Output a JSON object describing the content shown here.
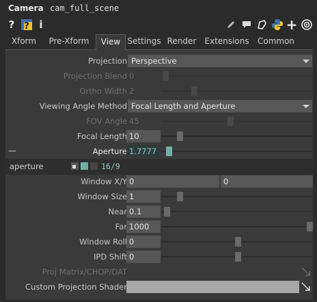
{
  "header": {
    "op_type": "Camera",
    "op_name": "cam_full_scene"
  },
  "toolbar": {
    "icons": [
      "help-icon",
      "python-help-icon",
      "info-icon",
      "edit-icon",
      "comment-icon",
      "clone-icon",
      "python-icon",
      "add-icon",
      "target-icon"
    ],
    "help_glyph": "?",
    "info_glyph": "i",
    "add_glyph": "+"
  },
  "tabs": [
    "Xform",
    "Pre-Xform",
    "View",
    "Settings",
    "Render",
    "Extensions",
    "Common"
  ],
  "active_tab": "View",
  "params": {
    "projection": {
      "label": "Projection",
      "value": "Perspective"
    },
    "projection_blend": {
      "label": "Projection Blend",
      "value": "0"
    },
    "ortho_width": {
      "label": "Ortho Width",
      "value": "2"
    },
    "viewing_angle_method": {
      "label": "Viewing Angle Method",
      "value": "Focal Length and Aperture"
    },
    "fov_angle": {
      "label": "FOV Angle",
      "value": "45"
    },
    "focal_length": {
      "label": "Focal Length",
      "value": "10"
    },
    "aperture": {
      "collapse_glyph": "—",
      "label": "Aperture",
      "value": "1.7777"
    },
    "aperture_expr": {
      "label": "aperture",
      "value": "16/9"
    },
    "window_xy": {
      "label": "Window X/Y",
      "x": "0",
      "y": "0"
    },
    "window_size": {
      "label": "Window Size",
      "value": "1"
    },
    "near": {
      "label": "Near",
      "value": "0.1"
    },
    "far": {
      "label": "Far",
      "value": "1000"
    },
    "window_roll": {
      "label": "Window Roll",
      "value": "0"
    },
    "ipd_shift": {
      "label": "IPD Shift",
      "value": "0"
    },
    "proj_matrix": {
      "label": "Proj Matrix/CHOP/DAT",
      "value": ""
    },
    "custom_projection_shader": {
      "label": "Custom Projection Shader",
      "value": ""
    }
  }
}
